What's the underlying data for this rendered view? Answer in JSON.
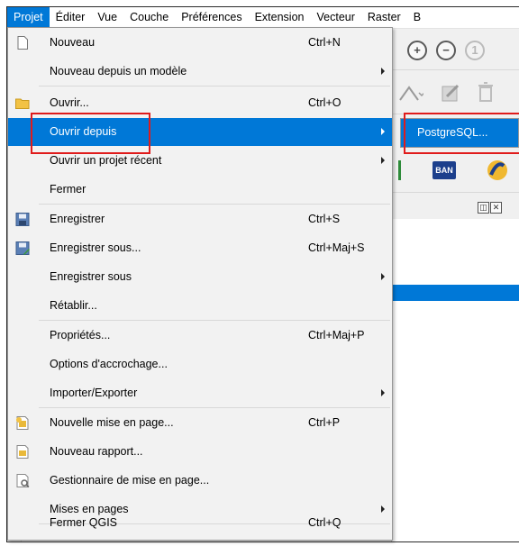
{
  "menubar": {
    "items": [
      {
        "label": "Projet"
      },
      {
        "label": "Éditer"
      },
      {
        "label": "Vue"
      },
      {
        "label": "Couche"
      },
      {
        "label": "Préférences"
      },
      {
        "label": "Extension"
      },
      {
        "label": "Vecteur"
      },
      {
        "label": "Raster"
      },
      {
        "label": "B"
      }
    ],
    "active": "Projet"
  },
  "project_menu": {
    "items": [
      {
        "label": "Nouveau",
        "shortcut": "Ctrl+N",
        "icon": "new-document-icon"
      },
      {
        "label": "Nouveau depuis un modèle",
        "has_submenu": true
      },
      {
        "label": "Ouvrir...",
        "shortcut": "Ctrl+O",
        "icon": "folder-icon"
      },
      {
        "label": "Ouvrir depuis",
        "has_submenu": true,
        "highlighted": true
      },
      {
        "label": "Ouvrir un projet récent",
        "has_submenu": true
      },
      {
        "label": "Fermer"
      },
      {
        "label": "Enregistrer",
        "shortcut": "Ctrl+S",
        "icon": "save-icon"
      },
      {
        "label": "Enregistrer sous...",
        "shortcut": "Ctrl+Maj+S",
        "icon": "save-as-icon"
      },
      {
        "label": "Enregistrer sous",
        "has_submenu": true
      },
      {
        "label": "Rétablir..."
      },
      {
        "label": "Propriétés...",
        "shortcut": "Ctrl+Maj+P"
      },
      {
        "label": "Options d'accrochage..."
      },
      {
        "label": "Importer/Exporter",
        "has_submenu": true
      },
      {
        "label": "Nouvelle mise en page...",
        "shortcut": "Ctrl+P",
        "icon": "new-layout-icon"
      },
      {
        "label": "Nouveau rapport...",
        "icon": "new-report-icon"
      },
      {
        "label": "Gestionnaire de mise en page...",
        "icon": "layout-manager-icon"
      },
      {
        "label": "Mises en pages",
        "has_submenu": true
      },
      {
        "label": "Fermer QGIS",
        "shortcut": "Ctrl+Q"
      }
    ]
  },
  "open_from_submenu": {
    "items": [
      {
        "label": "PostgreSQL..."
      }
    ]
  },
  "toolbar": {
    "ban_label": "BAN"
  },
  "colors": {
    "highlight": "#0078d7",
    "annotation": "#e01b1b"
  }
}
